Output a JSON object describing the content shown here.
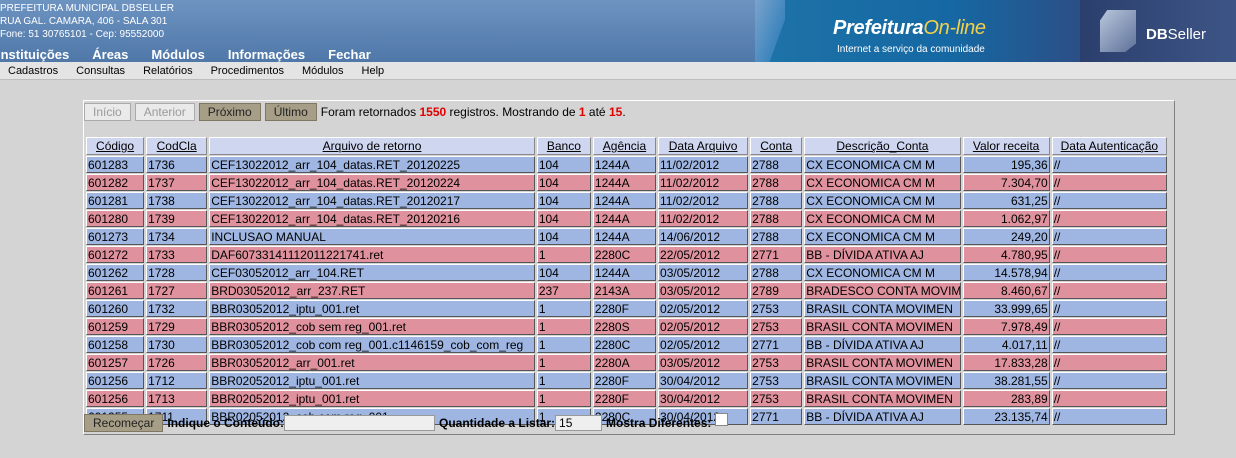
{
  "header": {
    "org_lines": [
      "PREFEITURA MUNICIPAL DBSELLER",
      "RUA GAL. CAMARA, 406 - SALA 301",
      "Fone: 51 30765101  -  Cep: 95552000"
    ],
    "nav": [
      "Instituições",
      "Áreas",
      "Módulos",
      "Informações",
      "Fechar"
    ],
    "brand_main": "Prefeitura",
    "brand_online": "On-line",
    "brand_sub": "Internet a serviço da comunidade",
    "seller_bold": "DB",
    "seller_rest": "Seller"
  },
  "menubar": [
    "Cadastros",
    "Consultas",
    "Relatórios",
    "Procedimentos",
    "Módulos",
    "Help"
  ],
  "pager": {
    "buttons": [
      "Início",
      "Anterior",
      "Próximo",
      "Último"
    ],
    "info_prefix": "Foram retornados ",
    "total": "1550",
    "info_mid": " registros. Mostrando de ",
    "from": "1",
    "info_ate": " até ",
    "to": "15",
    "info_end": "."
  },
  "table": {
    "columns": [
      "Código",
      "CodCla",
      "Arquivo de retorno",
      "Banco",
      "Agência",
      "Data Arquivo",
      "Conta",
      "Descrição_Conta",
      "Valor receita",
      "Data Autenticação"
    ],
    "rows": [
      [
        "601283",
        "1736",
        "CEF13022012_arr_104_datas.RET_20120225",
        "104",
        "1244A",
        "11/02/2012",
        "2788",
        "CX ECONOMICA CM M",
        "195,36",
        "//"
      ],
      [
        "601282",
        "1737",
        "CEF13022012_arr_104_datas.RET_20120224",
        "104",
        "1244A",
        "11/02/2012",
        "2788",
        "CX ECONOMICA CM M",
        "7.304,70",
        "//"
      ],
      [
        "601281",
        "1738",
        "CEF13022012_arr_104_datas.RET_20120217",
        "104",
        "1244A",
        "11/02/2012",
        "2788",
        "CX ECONOMICA CM M",
        "631,25",
        "//"
      ],
      [
        "601280",
        "1739",
        "CEF13022012_arr_104_datas.RET_20120216",
        "104",
        "1244A",
        "11/02/2012",
        "2788",
        "CX ECONOMICA CM M",
        "1.062,97",
        "//"
      ],
      [
        "601273",
        "1734",
        "INCLUSAO MANUAL",
        "104",
        "1244A",
        "14/06/2012",
        "2788",
        "CX ECONOMICA CM M",
        "249,20",
        "//"
      ],
      [
        "601272",
        "1733",
        "DAF6073314111201122174​1.ret",
        "1",
        "2280C",
        "22/05/2012",
        "2771",
        "BB - DÍVIDA ATIVA AJ",
        "4.780,95",
        "//"
      ],
      [
        "601262",
        "1728",
        "CEF03052012_arr_104.RET",
        "104",
        "1244A",
        "03/05/2012",
        "2788",
        "CX ECONOMICA CM M",
        "14.578,94",
        "//"
      ],
      [
        "601261",
        "1727",
        "BRD03052012_arr_237.RET",
        "237",
        "2143A",
        "03/05/2012",
        "2789",
        "BRADESCO CONTA MOVIM",
        "8.460,67",
        "//"
      ],
      [
        "601260",
        "1732",
        "BBR03052012_iptu_001.ret",
        "1",
        "2280F",
        "02/05/2012",
        "2753",
        "BRASIL CONTA MOVIMEN",
        "33.999,65",
        "//"
      ],
      [
        "601259",
        "1729",
        "BBR03052012_cob sem reg_001.ret",
        "1",
        "2280S",
        "02/05/2012",
        "2753",
        "BRASIL CONTA MOVIMEN",
        "7.978,49",
        "//"
      ],
      [
        "601258",
        "1730",
        "BBR03052012_cob com reg_001.c1146159_cob_com_reg",
        "1",
        "2280C",
        "02/05/2012",
        "2771",
        "BB - DÍVIDA ATIVA AJ",
        "4.017,11",
        "//"
      ],
      [
        "601257",
        "1726",
        "BBR03052012_arr_001.ret",
        "1",
        "2280A",
        "03/05/2012",
        "2753",
        "BRASIL CONTA MOVIMEN",
        "17.833,28",
        "//"
      ],
      [
        "601256",
        "1712",
        "BBR02052012_iptu_001.ret",
        "1",
        "2280F",
        "30/04/2012",
        "2753",
        "BRASIL CONTA MOVIMEN",
        "38.281,55",
        "//"
      ],
      [
        "601256",
        "1713",
        "BBR02052012_iptu_001.ret",
        "1",
        "2280F",
        "30/04/2012",
        "2753",
        "BRASIL CONTA MOVIMEN",
        "283,89",
        "//"
      ],
      [
        "601255",
        "1711",
        "BBR02052012_cob com reg_001.",
        "1",
        "2280C",
        "30/04/2012",
        "2771",
        "BB - DÍVIDA ATIVA AJ",
        "23.135,74",
        "//"
      ]
    ]
  },
  "filter": {
    "reset_label": "Recomeçar",
    "content_label": "Indique o Conteúdo:",
    "content_value": "",
    "qty_label": "Quantidade a Listar:",
    "qty_value": "15",
    "diff_label": "Mostra Diferentes:"
  },
  "colors": {
    "row_blue": "#9fb6e2",
    "row_pink": "#df929d",
    "header_blue": "#5b82b3",
    "accent_red": "#e00000"
  }
}
